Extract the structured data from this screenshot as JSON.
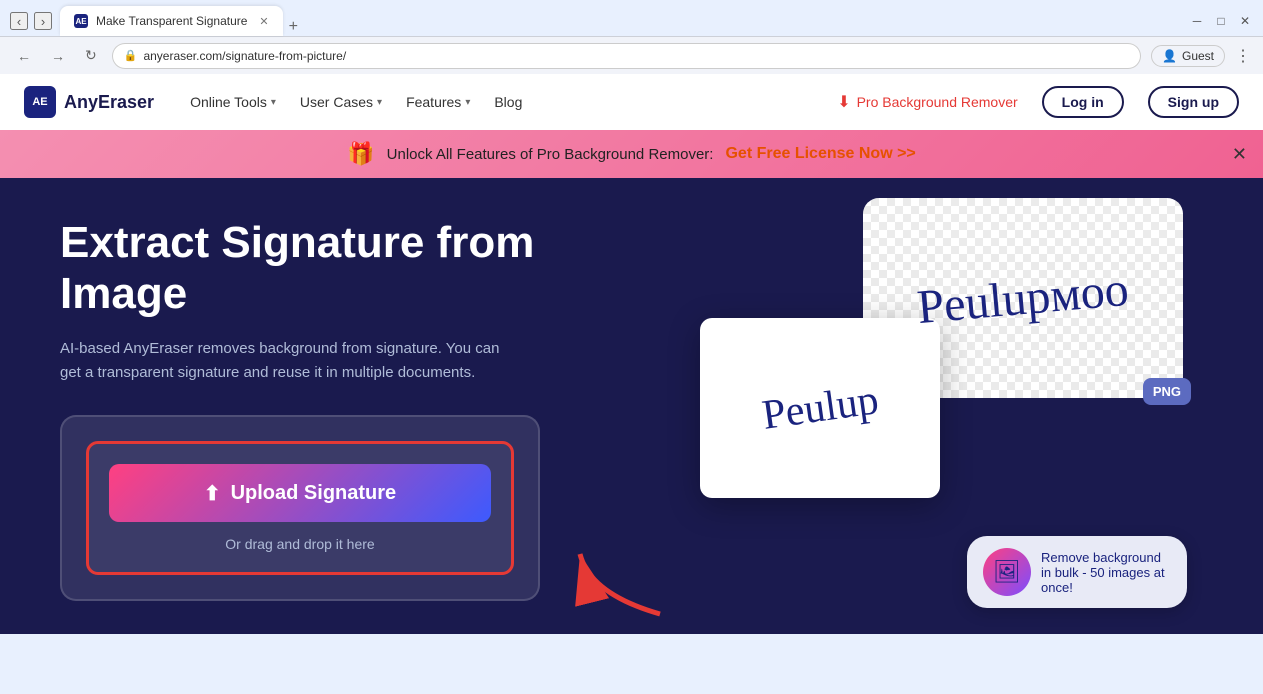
{
  "browser": {
    "tab_title": "Make Transparent Signature",
    "tab_favicon": "AE",
    "url": "anyeraser.com/signature-from-picture/",
    "new_tab_label": "+",
    "profile_label": "Guest",
    "back_arrow": "←",
    "forward_arrow": "→",
    "refresh_icon": "↻",
    "more_icon": "⋮",
    "minimize_icon": "─",
    "maximize_icon": "□",
    "close_icon": "✕"
  },
  "navbar": {
    "logo_abbr": "AE",
    "logo_name": "AnyEraser",
    "online_tools_label": "Online Tools",
    "user_cases_label": "User Cases",
    "features_label": "Features",
    "blog_label": "Blog",
    "pro_label": "Pro Background Remover",
    "login_label": "Log in",
    "signup_label": "Sign up"
  },
  "banner": {
    "text": "Unlock All Features of Pro Background Remover:",
    "link_text": "Get Free License Now >>",
    "close_label": "✕"
  },
  "hero": {
    "title": "Extract Signature from Image",
    "subtitle": "AI-based AnyEraser removes background from signature. You can get a transparent signature and reuse it in multiple documents.",
    "upload_btn_label": "Upload Signature",
    "drag_text": "Or drag and drop it here",
    "png_badge": "PNG",
    "bulk_text": "Remove background in bulk - 50 images at once!"
  },
  "upload": {
    "icon": "⬆"
  }
}
